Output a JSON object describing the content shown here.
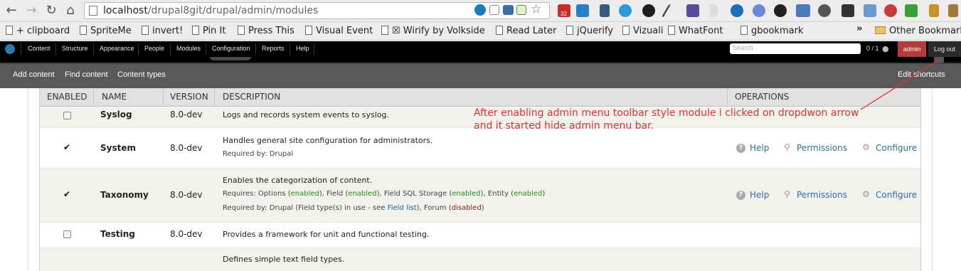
{
  "browser": {
    "url_host": "localhost",
    "url_path": "/drupal8git/drupal/admin/modules",
    "badge_count": "32",
    "bookmarks": [
      "+ clipboard",
      "SpriteMe",
      "invert!",
      "Pin It",
      "Press This",
      "Visual Event",
      "☒ Wirify by Volkside",
      "Read Later",
      "jQuerify",
      "Vizuali",
      "WhatFont",
      "gbookmark"
    ],
    "overflow": "»",
    "other_bookmarks": "Other Bookmarks"
  },
  "toolbar": {
    "menu": [
      "Content",
      "Structure",
      "Appearance",
      "People",
      "Modules",
      "Configuration",
      "Reports",
      "Help"
    ],
    "search_placeholder": "Search",
    "counter": "0 / 1",
    "user": "admin",
    "logout": "Log out"
  },
  "shortcuts": {
    "items": [
      "Add content",
      "Find content",
      "Content types"
    ],
    "edit": "Edit shortcuts"
  },
  "table": {
    "headers": [
      "ENABLED",
      "NAME",
      "VERSION",
      "DESCRIPTION",
      "OPERATIONS"
    ],
    "rows": [
      {
        "name": "Syslog",
        "version": "8.0-dev",
        "desc": "Logs and records system events to syslog.",
        "enabled": false
      },
      {
        "name": "System",
        "version": "8.0-dev",
        "desc": "Handles general site configuration for administrators.",
        "required_by": "Required by: Drupal",
        "enabled": true,
        "ops": [
          "Help",
          "Permissions",
          "Configure"
        ]
      },
      {
        "name": "Taxonomy",
        "version": "8.0-dev",
        "desc": "Enables the categorization of content.",
        "enabled": true,
        "requires": {
          "prefix": "Requires: ",
          "items": [
            {
              "label": "Options",
              "status": "enabled"
            },
            {
              "label": "Field",
              "status": "enabled"
            },
            {
              "label": "Field SQL Storage",
              "status": "enabled"
            },
            {
              "label": "Entity",
              "status": "enabled"
            }
          ]
        },
        "required_by": {
          "prefix": "Required by: Drupal (Field type(s) in use - see ",
          "link": "Field list",
          "mid": "), Forum (",
          "status": "disabled",
          "suffix": ")"
        },
        "ops": [
          "Help",
          "Permissions",
          "Configure"
        ]
      },
      {
        "name": "Testing",
        "version": "8.0-dev",
        "desc": "Provides a framework for unit and functional testing.",
        "enabled": false
      },
      {
        "name": "",
        "version": "",
        "desc": "Defines simple text field types.",
        "enabled": false
      }
    ]
  },
  "annotation": {
    "line1": "After enabling admin menu toolbar style module i clicked on dropdwon arrow",
    "line2": "and it started hide admin menu bar.",
    "color": "#e03030"
  }
}
